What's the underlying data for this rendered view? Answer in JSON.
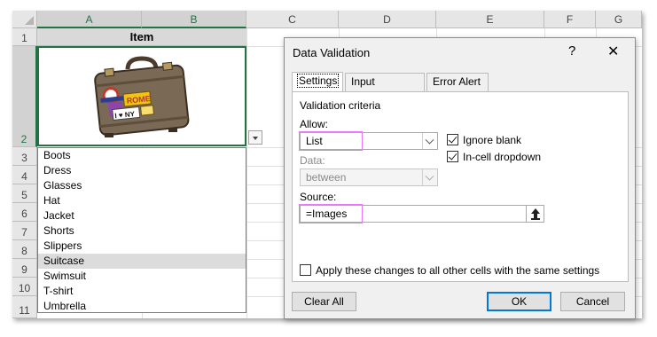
{
  "sheet": {
    "columns": [
      "A",
      "B",
      "C",
      "D",
      "E",
      "F",
      "G"
    ],
    "rows": [
      "1",
      "2",
      "3",
      "4",
      "5",
      "6",
      "7",
      "8",
      "9",
      "10",
      "11"
    ],
    "header_cell": "Item",
    "image_cell_content": "suitcase image",
    "dropdown_items": [
      "Boots",
      "Dress",
      "Glasses",
      "Hat",
      "Jacket",
      "Shorts",
      "Slippers",
      "Suitcase",
      "Swimsuit",
      "T-shirt",
      "Umbrella"
    ],
    "highlighted_item": "Suitcase",
    "sticker_text_rome": "ROME",
    "sticker_text_ny": "I ♥ NY"
  },
  "dialog": {
    "title": "Data Validation",
    "help": "?",
    "close": "✕",
    "tabs": [
      "Settings",
      "Input Message",
      "Error Alert"
    ],
    "active_tab": "Settings",
    "group_title": "Validation criteria",
    "allow_label": "Allow:",
    "allow_value": "List",
    "data_label": "Data:",
    "data_value": "between",
    "source_label": "Source:",
    "source_value": "=Images",
    "ignore_blank_label": "Ignore blank",
    "ignore_blank_checked": true,
    "in_cell_dropdown_label": "In-cell dropdown",
    "in_cell_dropdown_checked": true,
    "apply_all_label": "Apply these changes to all other cells with the same settings",
    "apply_all_checked": false,
    "clear_all": "Clear All",
    "ok": "OK",
    "cancel": "Cancel"
  },
  "colors": {
    "excel_green": "#217346",
    "highlight_pink": "#e879f9",
    "focus_blue": "#0078d7"
  }
}
